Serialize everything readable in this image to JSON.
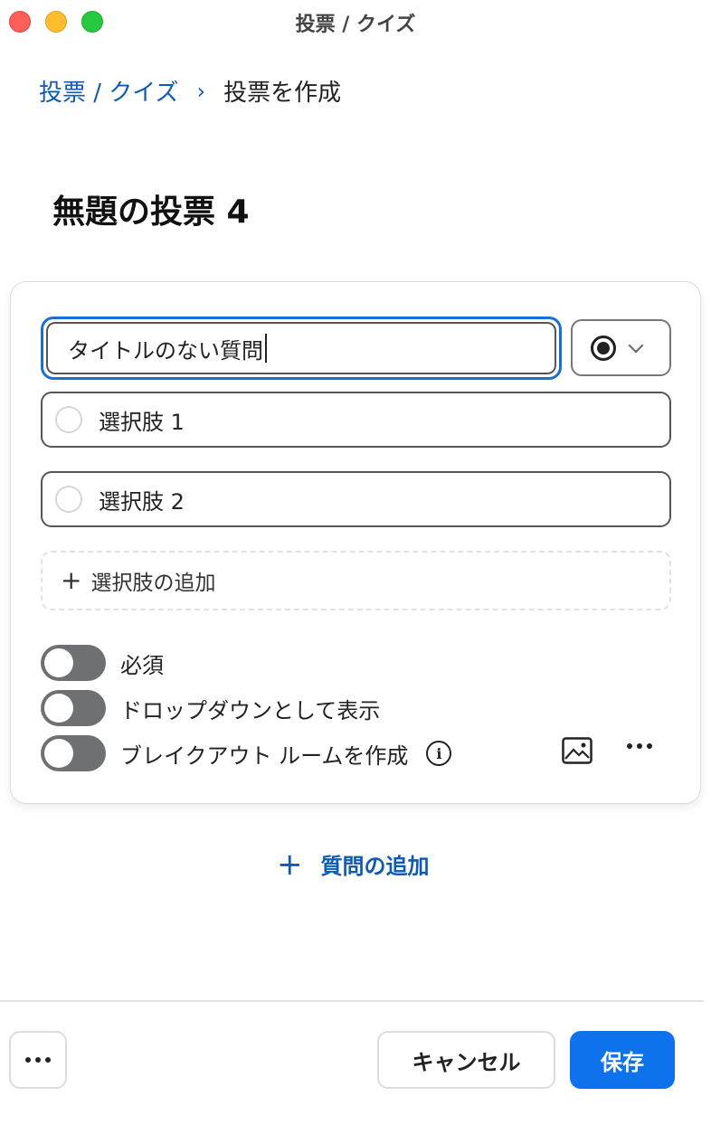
{
  "window": {
    "title": "投票 / クイズ"
  },
  "breadcrumb": {
    "parent": "投票 / クイズ",
    "separator": "›",
    "current": "投票を作成"
  },
  "poll": {
    "title": "無題の投票 4"
  },
  "question": {
    "title_value": "タイトルのない質問",
    "type_icon": "radio-dot-icon",
    "options": [
      {
        "label": "選択肢 1"
      },
      {
        "label": "選択肢 2"
      }
    ],
    "add_option_label": "選択肢の追加",
    "toggles": {
      "required": {
        "label": "必須",
        "on": false
      },
      "dropdown": {
        "label": "ドロップダウンとして表示",
        "on": false
      },
      "breakout": {
        "label": "ブレイクアウト ルームを作成",
        "on": false
      }
    }
  },
  "add_question_label": "質問の追加",
  "footer": {
    "cancel_label": "キャンセル",
    "save_label": "保存"
  },
  "colors": {
    "accent": "#0e72ed",
    "link": "#0e5bb5",
    "focus_border": "#1a6fd4",
    "toggle_off": "#6e7074"
  }
}
